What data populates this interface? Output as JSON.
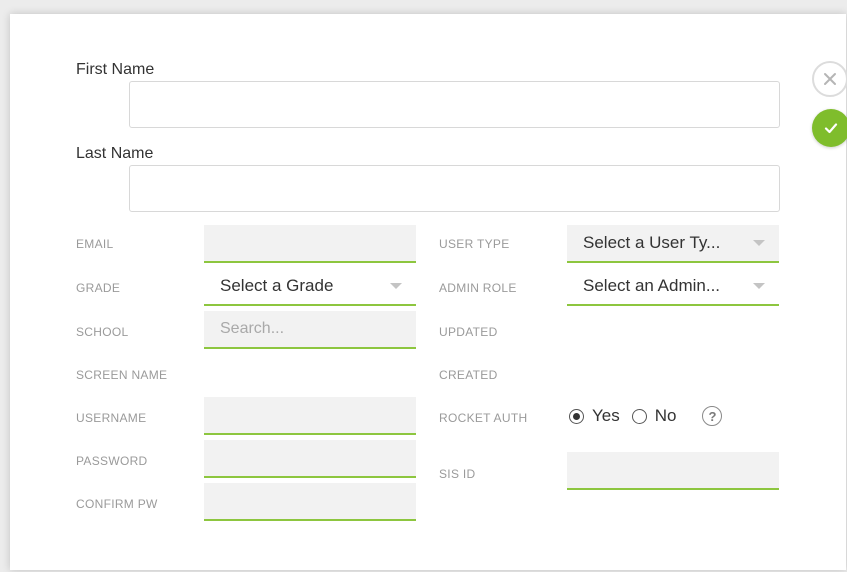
{
  "form": {
    "first_name": {
      "label": "First Name",
      "value": ""
    },
    "last_name": {
      "label": "Last Name",
      "value": ""
    },
    "email": {
      "label": "EMAIL",
      "value": ""
    },
    "grade": {
      "label": "GRADE",
      "selected": "Select a Grade"
    },
    "school": {
      "label": "SCHOOL",
      "placeholder": "Search..."
    },
    "screen_name": {
      "label": "SCREEN NAME"
    },
    "username": {
      "label": "USERNAME",
      "value": ""
    },
    "password": {
      "label": "PASSWORD",
      "value": ""
    },
    "confirm_pw": {
      "label": "CONFIRM PW",
      "value": ""
    },
    "user_type": {
      "label": "USER TYPE",
      "selected": "Select a User Ty..."
    },
    "admin_role": {
      "label": "ADMIN ROLE",
      "selected": "Select an Admin..."
    },
    "updated": {
      "label": "UPDATED"
    },
    "created": {
      "label": "CREATED"
    },
    "rocket_auth": {
      "label": "ROCKET AUTH",
      "options": [
        "Yes",
        "No"
      ],
      "selected": "Yes"
    },
    "sis_id": {
      "label": "SIS ID",
      "value": ""
    }
  },
  "actions": {
    "close_icon": "close-icon",
    "confirm_icon": "checkmark-icon",
    "help_icon": "question-icon"
  },
  "colors": {
    "accent": "#8dc63f",
    "confirm_button": "#7fbd2c"
  }
}
